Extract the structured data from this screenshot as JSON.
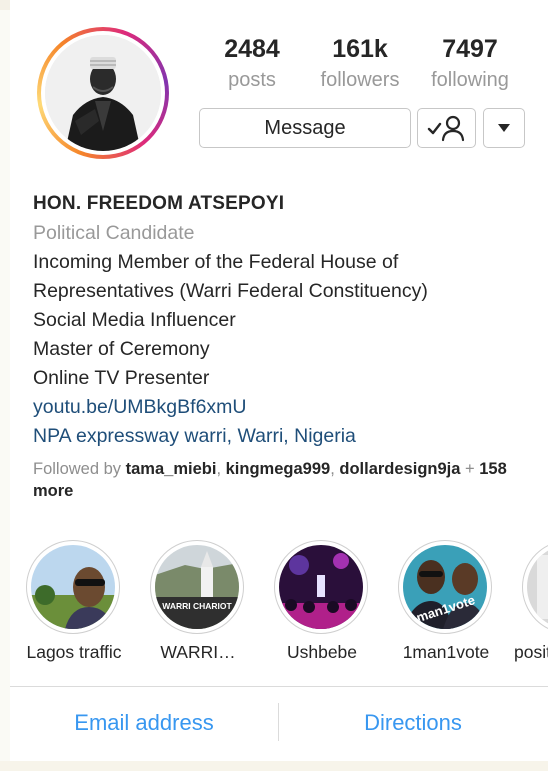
{
  "profile": {
    "stats": [
      {
        "value": "2484",
        "label": "posts"
      },
      {
        "value": "161k",
        "label": "followers"
      },
      {
        "value": "7497",
        "label": "following"
      }
    ],
    "message_label": "Message",
    "name": "HON. FREEDOM ATSEPOYI",
    "category": "Political Candidate",
    "bio_lines": [
      "Incoming Member of the Federal House of",
      "Representatives (Warri Federal Constituency)",
      "Social Media Influencer",
      "Master of Ceremony",
      "Online TV Presenter"
    ],
    "website": "youtu.be/UMBkgBf6xmU",
    "location": "NPA expressway warri, Warri, Nigeria",
    "followed_by": {
      "prefix": "Followed by",
      "users": [
        "tama_miebi",
        "kingmega999",
        "dollardesign9ja"
      ],
      "suffix_plus": "+",
      "suffix_count": "158",
      "suffix_more": "more"
    }
  },
  "highlights": [
    {
      "label": "Lagos traffic",
      "overlay": ""
    },
    {
      "label": "WARRI…",
      "overlay": "WARRI CHARIOT"
    },
    {
      "label": "Ushbebe",
      "overlay": ""
    },
    {
      "label": "1man1vote",
      "overlay": "man1vote"
    },
    {
      "label": "posit",
      "overlay": ""
    }
  ],
  "actions": {
    "email": "Email address",
    "directions": "Directions"
  },
  "icons": {
    "follow": "person-check-icon",
    "dropdown": "caret-down-icon"
  },
  "colors": {
    "link": "#1f4e79",
    "action": "#3897f0",
    "muted": "#999999"
  }
}
